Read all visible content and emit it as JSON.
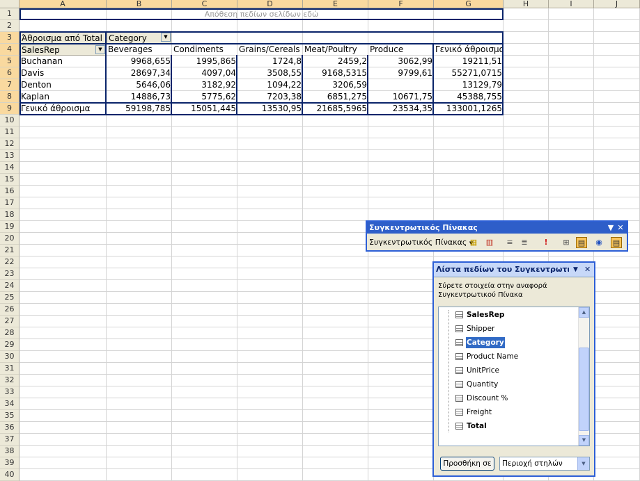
{
  "columns": [
    "A",
    "B",
    "C",
    "D",
    "E",
    "F",
    "G",
    "H",
    "I",
    "J"
  ],
  "rows": [
    "1",
    "2",
    "3",
    "4",
    "5",
    "6",
    "7",
    "8",
    "9",
    "10",
    "11",
    "12",
    "13",
    "14",
    "15",
    "16",
    "17",
    "18",
    "19",
    "20",
    "21",
    "22",
    "23",
    "24",
    "25",
    "26",
    "27",
    "28",
    "29",
    "30",
    "31",
    "32",
    "33",
    "34",
    "35",
    "36",
    "37",
    "38",
    "39",
    "40"
  ],
  "pivot": {
    "page_drop_hint": "Απόθεση πεδίων σελίδων εδώ",
    "data_field": "Άθροισμα από Total",
    "column_field": "Category",
    "row_field": "SalesRep",
    "column_headers": [
      "Beverages",
      "Condiments",
      "Grains/Cereals",
      "Meat/Poultry",
      "Produce",
      "Γενικό άθροισμα"
    ],
    "rows": [
      {
        "label": "Buchanan",
        "values": [
          "9968,655",
          "1995,865",
          "1724,8",
          "2459,2",
          "3062,99",
          "19211,51"
        ]
      },
      {
        "label": "Davis",
        "values": [
          "28697,34",
          "4097,04",
          "3508,55",
          "9168,5315",
          "9799,61",
          "55271,0715"
        ]
      },
      {
        "label": "Denton",
        "values": [
          "5646,06",
          "3182,92",
          "1094,22",
          "3206,59",
          "",
          "13129,79"
        ]
      },
      {
        "label": "Kaplan",
        "values": [
          "14886,73",
          "5775,62",
          "7203,38",
          "6851,275",
          "10671,75",
          "45388,755"
        ]
      }
    ],
    "total_row": {
      "label": "Γενικό άθροισμα",
      "values": [
        "59198,785",
        "15051,445",
        "13530,95",
        "21685,5965",
        "23534,35",
        "133001,1265"
      ]
    }
  },
  "pivot_toolbar": {
    "title": "Συγκεντρωτικός Πίνακας",
    "menu_label": "Συγκεντρωτικός Πίνακας"
  },
  "field_list": {
    "title": "Λίστα πεδίων του Συγκεντρωτικού Πίνακα",
    "instruction": "Σύρετε στοιχεία στην αναφορά Συγκεντρωτικού Πίνακα",
    "fields": [
      {
        "label": "SalesRep",
        "bold": true,
        "selected": false
      },
      {
        "label": "Shipper",
        "bold": false,
        "selected": false
      },
      {
        "label": "Category",
        "bold": true,
        "selected": true
      },
      {
        "label": "Product Name",
        "bold": false,
        "selected": false
      },
      {
        "label": "UnitPrice",
        "bold": false,
        "selected": false
      },
      {
        "label": "Quantity",
        "bold": false,
        "selected": false
      },
      {
        "label": "Discount %",
        "bold": false,
        "selected": false
      },
      {
        "label": "Freight",
        "bold": false,
        "selected": false
      },
      {
        "label": "Total",
        "bold": true,
        "selected": false
      }
    ],
    "add_button": "Προσθήκη σε",
    "area_value": "Περιοχή στηλών"
  }
}
